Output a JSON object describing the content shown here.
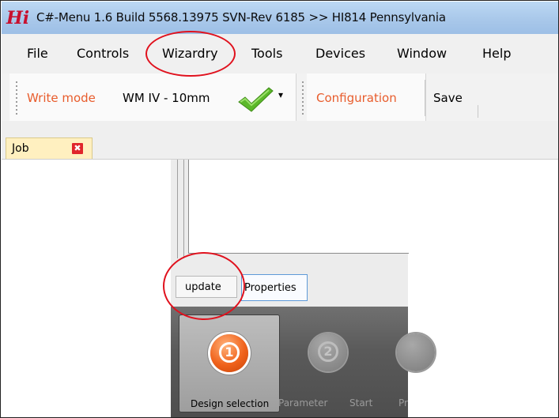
{
  "window": {
    "logo": "Hi",
    "title": "C#-Menu 1.6 Build 5568.13975 SVN-Rev 6185 >> HI814 Pennsylvania"
  },
  "menubar": {
    "items": [
      "File",
      "Controls",
      "Wizardry",
      "Tools",
      "Devices",
      "Window",
      "Help"
    ]
  },
  "toolbar": {
    "write_mode_label": "Write mode",
    "write_mode_value": "WM IV - 10mm",
    "dropdown_arrow": "▾",
    "configuration_label": "Configuration",
    "save_label": "Save"
  },
  "tabs": {
    "job_label": "Job",
    "close_glyph": "✖"
  },
  "inner": {
    "update_label": "update",
    "properties_label": "Properties",
    "steps": [
      {
        "number": "1",
        "label": "Design selection",
        "state": "active"
      },
      {
        "number": "2",
        "label": "Parameter",
        "state": "disabled"
      },
      {
        "number": "",
        "label": "Start",
        "state": "disabled"
      },
      {
        "number": "",
        "label": "Pr",
        "state": "disabled"
      }
    ]
  },
  "colors": {
    "accent_orange": "#e85c2c",
    "annotation_red": "#e0111d",
    "close_red": "#e0262b",
    "checkmark_green": "#5cb82a"
  },
  "icons": {
    "check": "check-icon",
    "close": "close-icon",
    "chevron": "chevron-down-icon"
  }
}
